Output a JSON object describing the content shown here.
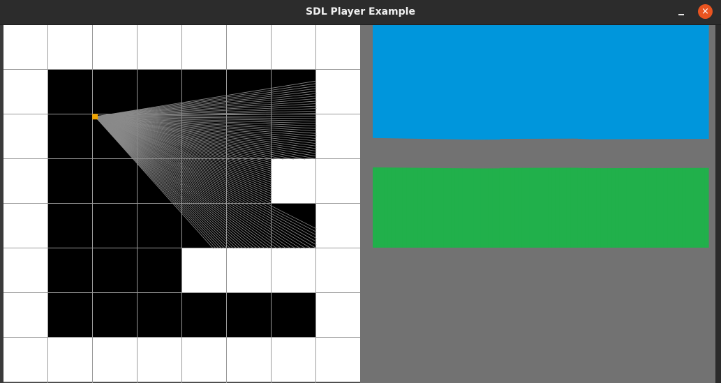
{
  "window": {
    "title": "SDL Player Example",
    "close_glyph": "×"
  },
  "icons": {
    "minimize": "minimize-icon",
    "close": "close-icon"
  },
  "map": {
    "rows": 8,
    "cols": 8,
    "cells": [
      [
        1,
        1,
        1,
        1,
        1,
        1,
        1,
        1
      ],
      [
        1,
        0,
        0,
        0,
        0,
        0,
        0,
        1
      ],
      [
        1,
        0,
        0,
        0,
        0,
        0,
        0,
        1
      ],
      [
        1,
        0,
        0,
        0,
        0,
        0,
        1,
        1
      ],
      [
        1,
        0,
        0,
        0,
        0,
        0,
        0,
        1
      ],
      [
        1,
        0,
        0,
        0,
        1,
        1,
        1,
        1
      ],
      [
        1,
        0,
        0,
        0,
        0,
        0,
        0,
        1
      ],
      [
        1,
        1,
        1,
        1,
        1,
        1,
        1,
        1
      ]
    ],
    "player": {
      "col": 2.05,
      "row": 2.05
    }
  },
  "colors": {
    "wall": "#ffffff",
    "floor": "#000000",
    "grid": "#9a9a9a",
    "ray": "#8a8a8a",
    "player": "#f0a400",
    "sky": "#0096dc",
    "ground": "#21b04b",
    "view_background": "#727272"
  }
}
